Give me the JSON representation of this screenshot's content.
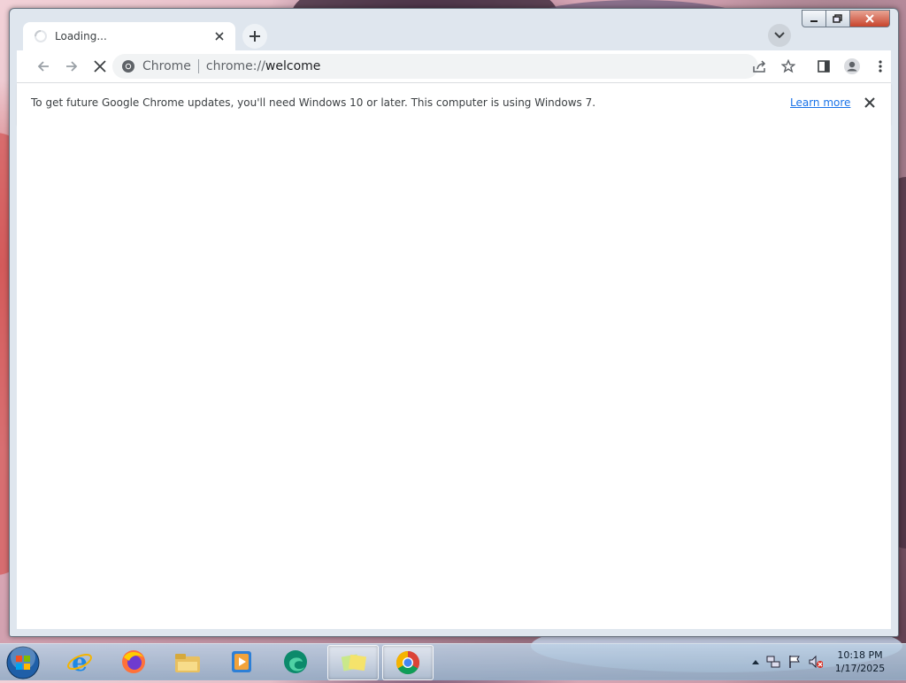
{
  "browser": {
    "tab": {
      "title": "Loading...",
      "close_label": "×"
    },
    "new_tab_label": "+",
    "address": {
      "site_name": "Chrome",
      "url_scheme": "chrome://",
      "url_path": "welcome"
    },
    "infobar": {
      "message": "To get future Google Chrome updates, you'll need Windows 10 or later. This computer is using Windows 7.",
      "link_label": "Learn more"
    }
  },
  "window_controls": [
    "minimize",
    "maximize",
    "close"
  ],
  "taskbar": {
    "pinned": [
      "internet-explorer",
      "firefox",
      "file-explorer",
      "media-player",
      "edge",
      "sticky-notes",
      "chrome"
    ],
    "active_app": "chrome",
    "clock": {
      "time": "10:18 PM",
      "date": "1/17/2025"
    }
  },
  "colors": {
    "accent_link": "#1a73e8",
    "chrome_frame": "#dfe6ee",
    "omnibox_bg": "#f1f3f4"
  }
}
